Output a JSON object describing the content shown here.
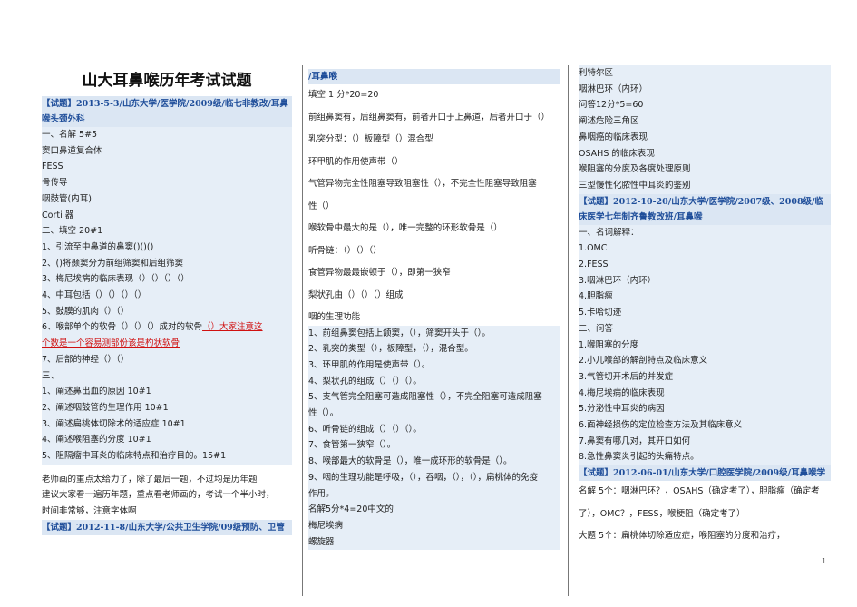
{
  "col1": {
    "title": "山大耳鼻喉历年考试试题",
    "exam1": "【试题】2013-5-3/山东大学/医学院/2009级/临七非教改/耳鼻喉头颈外科",
    "l01": "一、名解 5#5",
    "l02": "窦口鼻道复合体",
    "l03": "FESS",
    "l04": "骨传导",
    "l05": "咽鼓管(内耳)",
    "l06": "Corti 器",
    "l07": "二、填空 20#1",
    "l08": "1、引流至中鼻道的鼻窦()()()",
    "l09": "2、()将颞窦分为前组筛窦和后组筛窦",
    "l10": "3、梅尼埃病的临床表现（）（）（）（）",
    "l11": "4、中耳包括（）（）（）（）",
    "l12": "5、鼓膜的肌肉（）（）",
    "l13a": "6、喉部单个的软骨（）（）（）成对的软骨",
    "l13b": "（）大家注意这",
    "l14": "个数是一个容易测部份该是杓状软骨",
    "l15": "7、后部的神经（）（）",
    "l16": "三、",
    "l17": "1、阐述鼻出血的原因 10#1",
    "l18": "2、阐述咽鼓管的生理作用 10#1",
    "l19": "3、阐述扁桃体切除术的适应症 10#1",
    "l20": "4、阐述喉阻塞的分度 10#1",
    "l21": "5、阻隔瘤中耳炎的临床特点和治疗目的。15#1",
    "l22": "老师画的重点太给力了，除了最后一题，不过均是历年题",
    "l23": "建议大家看一遍历年题，重点看老师画的，考试一个半小时，",
    "l24": "时间非常够，注意字体啊",
    "exam2": "【试题】2012-11-8/山东大学/公共卫生学院/09级预防、卫管"
  },
  "col2": {
    "l01": "/耳鼻喉",
    "l02": "填空 1 分*20=20",
    "l03": "前组鼻窦有，后组鼻窦有，前者开口于上鼻道，后者开口于（）",
    "l04": "乳突分型：（）板障型（）混合型",
    "l05": "环甲肌的作用使声带（）",
    "l06": "气管异物完全性阻塞导致阻塞性（），不完全性阻塞导致阻塞",
    "l07": "性（）",
    "l08": "喉软骨中最大的是（），唯一完整的环形软骨是（）",
    "l09": "听骨链：（）（）（）",
    "l10": "食管异物最最嵌顿于（），即第一狭窄",
    "l11": "梨状孔由（）（）（）组成",
    "l12": "咽的生理功能",
    "l13": "1、前组鼻窦包括上颌窦，（），筛窦开头于（）。",
    "l14": "2、乳突的类型（），板障型，（），混合型。",
    "l15": "3、环甲肌的作用是使声带（）。",
    "l16": "4、梨状孔的组成（）（）（）。",
    "l17": "5、支气管完全阻塞可造成阻塞性（），不完全阻塞可造成阻塞",
    "l18": "性（）。",
    "l19": "6、听骨链的组成（）（）（）。",
    "l20": "7、食管第一狭窄（）。",
    "l21": "8、喉部最大的软骨是（），唯一成环形的软骨是（）。",
    "l22": "9、咽的生理功能是呼吸，（），吞咽，（），（），扁桃体的免疫",
    "l23": "作用。",
    "l24": "名解5分*4=20中文的",
    "l25": "梅尼埃病",
    "l26": "螺旋器"
  },
  "col3": {
    "l01": "利特尔区",
    "l02": "咽淋巴环（内环）",
    "l03": "问答12分*5=60",
    "l04": "阐述危险三角区",
    "l05": "鼻咽癌的临床表现",
    "l06": "OSAHS 的临床表现",
    "l07": "喉阻塞的分度及各度处理原则",
    "l08": "三型慢性化脓性中耳炎的鉴别",
    "exam3": "【试题】2012-10-20/山东大学/医学院/2007级、2008级/临床医学七年制齐鲁教改班/耳鼻喉",
    "l09": "一、名词解释：",
    "l10": "1.OMC",
    "l11": "2.FESS",
    "l12": "3.咽淋巴环（内环）",
    "l13": "4.胆脂瘤",
    "l14": "5.卡哈切迹",
    "l15": "二、问答",
    "l16": "1.喉阻塞的分度",
    "l17": "2.小儿喉部的解剖特点及临床意义",
    "l18": "3.气管切开术后的并发症",
    "l19": "4.梅尼埃病的临床表现",
    "l20": "5.分泌性中耳炎的病因",
    "l21": "6.面神经损伤的定位检查方法及其临床意义",
    "l22": "7.鼻窦有哪几对，其开口如何",
    "l23": "8.急性鼻窦炎引起的头痛特点。",
    "exam4": "【试题】2012-06-01/山东大学/口腔医学院/2009级/耳鼻喉学",
    "l24": "名解 5个：咽淋巴环？，OSAHS（确定考了），胆脂瘤（确定考",
    "l25": "了），OMC？，FESS，喉梗阻（确定考了）",
    "l26": "大题 5个：扁桃体切除适应症，喉阻塞的分度和治疗，"
  },
  "page_number": "1"
}
